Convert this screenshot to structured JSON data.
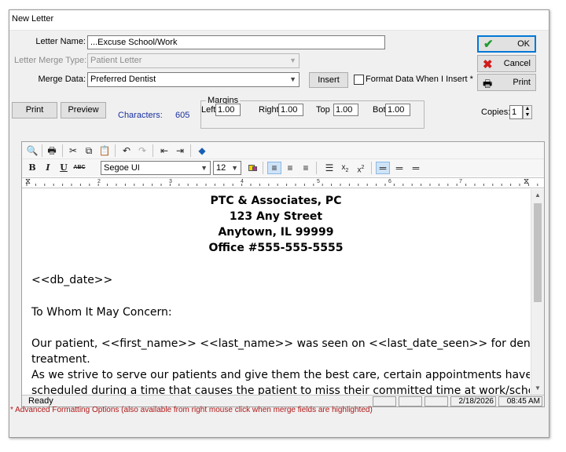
{
  "window": {
    "title": "New Letter"
  },
  "form": {
    "letter_name_label": "Letter Name:",
    "letter_name_value": "...Excuse School/Work",
    "merge_type_label": "Letter Merge Type:",
    "merge_type_value": "Patient Letter",
    "merge_data_label": "Merge Data:",
    "merge_data_value": "Preferred Dentist",
    "insert_label": "Insert",
    "format_check_label": "Format Data When I Insert *"
  },
  "buttons": {
    "ok": "OK",
    "cancel": "Cancel",
    "print": "Print"
  },
  "row2": {
    "print_label": "Print",
    "preview_label": "Preview",
    "characters_label": "Characters:",
    "characters_value": "605",
    "margins_legend": "Margins",
    "left_label": "Left",
    "left_value": "1.00",
    "right_label": "Right",
    "right_value": "1.00",
    "top_label": "Top",
    "top_value": "1.00",
    "bot_label": "Bot",
    "bot_value": "1.00",
    "copies_label": "Copies:",
    "copies_value": "1"
  },
  "editor": {
    "font_name": "Segoe UI",
    "font_size": "12",
    "ruler_numbers": [
      "2",
      "3",
      "4",
      "5",
      "6",
      "7"
    ],
    "header_lines": [
      "PTC & Associates, PC",
      "123 Any Street",
      "Anytown, IL   99999",
      "Office #555-555-5555"
    ],
    "date_field": "<<db_date>>",
    "salutation": "To Whom It May Concern:",
    "para1_line1": "Our patient, <<first_name>> <<last_name>> was seen on <<last_date_seen>> for dental",
    "para1_line2": "treatment.",
    "para2_line1": "As we strive to serve our patients and give them the best care, certain appointments have to be",
    "para2_line2": "scheduled during a time that causes the patient to miss their committed time at work/school."
  },
  "status": {
    "text": "Ready",
    "date": "2/18/2026",
    "time": "08:45 AM"
  },
  "footnote": "* Advanced Formatting Options (also available from right mouse click when merge fields are highlighted)",
  "icons": [
    "check-icon",
    "x-icon",
    "printer-icon",
    "binoculars-icon",
    "cut-icon",
    "copy-icon",
    "paste-icon",
    "undo-icon",
    "redo-icon",
    "outdent-icon",
    "indent-icon",
    "merge-field-icon"
  ]
}
